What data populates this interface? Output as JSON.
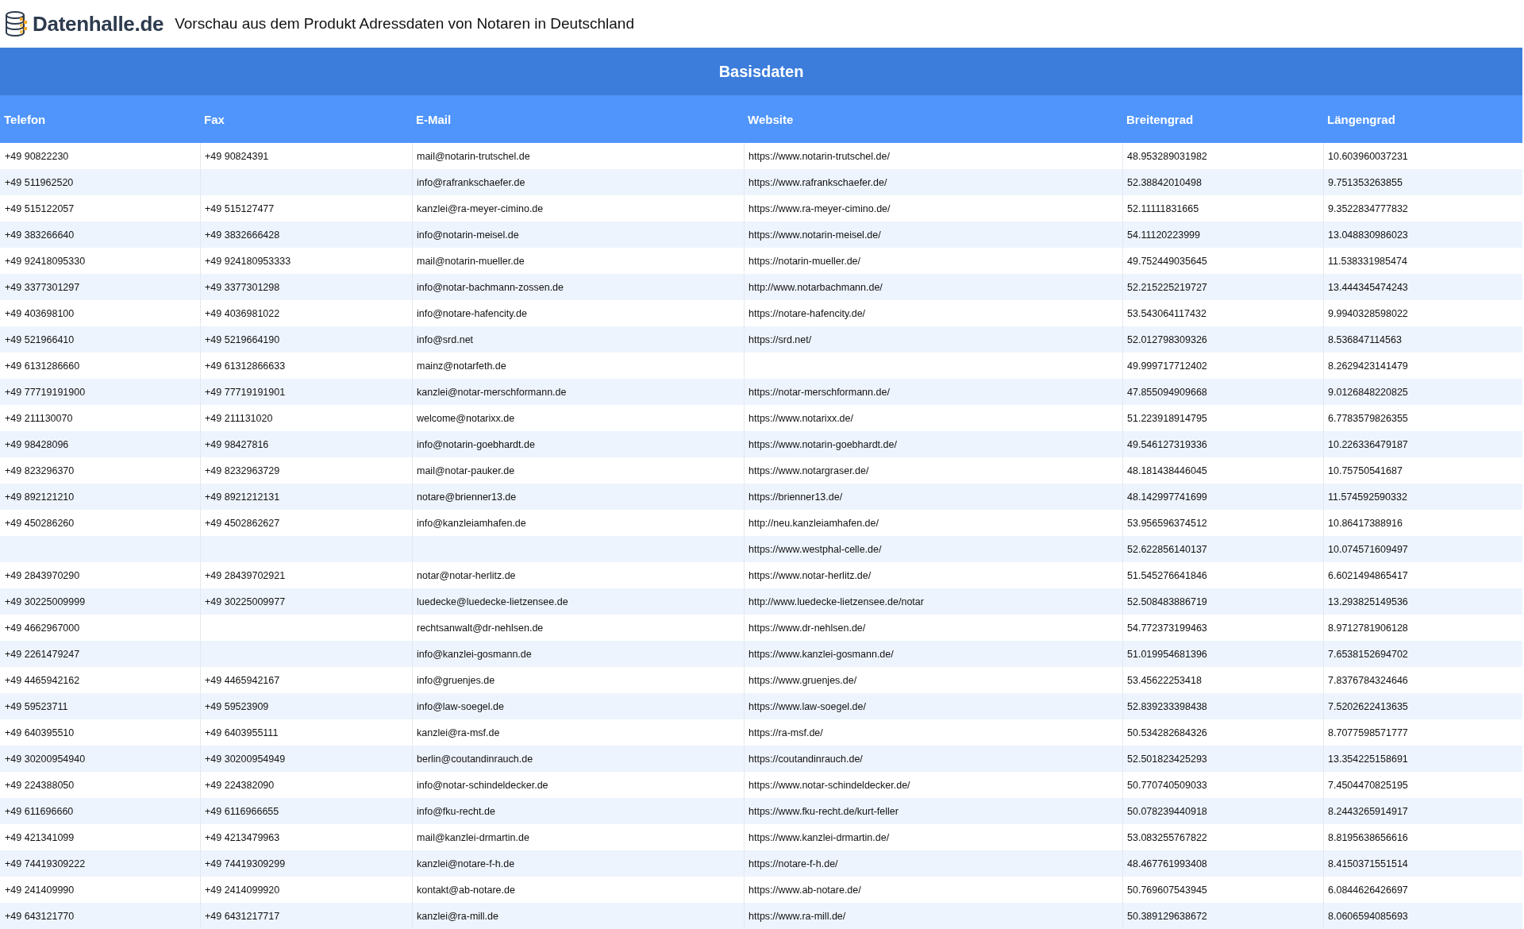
{
  "header": {
    "logo_text": "Datenhalle.de",
    "title": "Vorschau aus dem Produkt Adressdaten von Notaren in Deutschland"
  },
  "table": {
    "section_title": "Basisdaten",
    "columns": [
      "Telefon",
      "Fax",
      "E-Mail",
      "Website",
      "Breitengrad",
      "Längengrad"
    ],
    "rows": [
      {
        "phone": "+49 90822230",
        "fax": "+49 90824391",
        "email": "mail@notarin-trutschel.de",
        "website": "https://www.notarin-trutschel.de/",
        "latitude": "48.953289031982",
        "longitude": "10.603960037231"
      },
      {
        "phone": "+49 511962520",
        "email": "info@rafrankschaefer.de",
        "website": "https://www.rafrankschaefer.de/",
        "latitude": "52.38842010498",
        "longitude": "9.751353263855"
      },
      {
        "phone": "+49 515122057",
        "fax": "+49 515127477",
        "email": "kanzlei@ra-meyer-cimino.de",
        "website": "https://www.ra-meyer-cimino.de/",
        "latitude": "52.11111831665",
        "longitude": "9.3522834777832"
      },
      {
        "phone": "+49 383266640",
        "fax": "+49 3832666428",
        "email": "info@notarin-meisel.de",
        "website": "https://www.notarin-meisel.de/",
        "latitude": "54.11120223999",
        "longitude": "13.048830986023"
      },
      {
        "phone": "+49 92418095330",
        "fax": "+49 924180953333",
        "email": "mail@notarin-mueller.de",
        "website": "https://notarin-mueller.de/",
        "latitude": "49.752449035645",
        "longitude": "11.538331985474"
      },
      {
        "phone": "+49 3377301297",
        "fax": "+49 3377301298",
        "email": "info@notar-bachmann-zossen.de",
        "website": "http://www.notarbachmann.de/",
        "latitude": "52.215225219727",
        "longitude": "13.444345474243"
      },
      {
        "phone": "+49 403698100",
        "fax": "+49 4036981022",
        "email": "info@notare-hafencity.de",
        "website": "https://notare-hafencity.de/",
        "latitude": "53.543064117432",
        "longitude": "9.9940328598022"
      },
      {
        "phone": "+49 521966410",
        "fax": "+49 5219664190",
        "email": "info@srd.net",
        "website": "https://srd.net/",
        "latitude": "52.012798309326",
        "longitude": "8.536847114563"
      },
      {
        "phone": "+49 6131286660",
        "fax": "+49 61312866633",
        "email": "mainz@notarfeth.de",
        "latitude": "49.999717712402",
        "longitude": "8.2629423141479"
      },
      {
        "phone": "+49 77719191900",
        "fax": "+49 77719191901",
        "email": "kanzlei@notar-merschformann.de",
        "website": "https://notar-merschformann.de/",
        "latitude": "47.855094909668",
        "longitude": "9.0126848220825"
      },
      {
        "phone": "+49 211130070",
        "fax": "+49 211131020",
        "email": "welcome@notarixx.de",
        "website": "https://www.notarixx.de/",
        "latitude": "51.223918914795",
        "longitude": "6.7783579826355"
      },
      {
        "phone": "+49 98428096",
        "fax": "+49 98427816",
        "email": "info@notarin-goebhardt.de",
        "website": "https://www.notarin-goebhardt.de/",
        "latitude": "49.546127319336",
        "longitude": "10.226336479187"
      },
      {
        "phone": "+49 823296370",
        "fax": "+49 8232963729",
        "email": "mail@notar-pauker.de",
        "website": "https://www.notargraser.de/",
        "latitude": "48.181438446045",
        "longitude": "10.75750541687"
      },
      {
        "phone": "+49 892121210",
        "fax": "+49 8921212131",
        "email": "notare@brienner13.de",
        "website": "https://brienner13.de/",
        "latitude": "48.142997741699",
        "longitude": "11.574592590332"
      },
      {
        "phone": "+49 450286260",
        "fax": "+49 4502862627",
        "email": "info@kanzleiamhafen.de",
        "website": "http://neu.kanzleiamhafen.de/",
        "latitude": "53.956596374512",
        "longitude": "10.86417388916"
      },
      {
        "website": "https://www.westphal-celle.de/",
        "latitude": "52.622856140137",
        "longitude": "10.074571609497"
      },
      {
        "phone": "+49 2843970290",
        "fax": "+49 28439702921",
        "email": "notar@notar-herlitz.de",
        "website": "https://www.notar-herlitz.de/",
        "latitude": "51.545276641846",
        "longitude": "6.6021494865417"
      },
      {
        "phone": "+49 30225009999",
        "fax": "+49 30225009977",
        "email": "luedecke@luedecke-lietzensee.de",
        "website": "http://www.luedecke-lietzensee.de/notar",
        "latitude": "52.508483886719",
        "longitude": "13.293825149536"
      },
      {
        "phone": "+49 4662967000",
        "email": "rechtsanwalt@dr-nehlsen.de",
        "website": "https://www.dr-nehlsen.de/",
        "latitude": "54.772373199463",
        "longitude": "8.9712781906128"
      },
      {
        "phone": "+49 2261479247",
        "email": "info@kanzlei-gosmann.de",
        "website": "https://www.kanzlei-gosmann.de/",
        "latitude": "51.019954681396",
        "longitude": "7.6538152694702"
      },
      {
        "phone": "+49 4465942162",
        "fax": "+49 4465942167",
        "email": "info@gruenjes.de",
        "website": "https://www.gruenjes.de/",
        "latitude": "53.45622253418",
        "longitude": "7.8376784324646"
      },
      {
        "phone": "+49 59523711",
        "fax": "+49 59523909",
        "email": "info@law-soegel.de",
        "website": "https://www.law-soegel.de/",
        "latitude": "52.839233398438",
        "longitude": "7.5202622413635"
      },
      {
        "phone": "+49 640395510",
        "fax": "+49 6403955111",
        "email": "kanzlei@ra-msf.de",
        "website": "https://ra-msf.de/",
        "latitude": "50.534282684326",
        "longitude": "8.7077598571777"
      },
      {
        "phone": "+49 30200954940",
        "fax": "+49 30200954949",
        "email": "berlin@coutandinrauch.de",
        "website": "https://coutandinrauch.de/",
        "latitude": "52.501823425293",
        "longitude": "13.354225158691"
      },
      {
        "phone": "+49 224388050",
        "fax": "+49 224382090",
        "email": "info@notar-schindeldecker.de",
        "website": "https://www.notar-schindeldecker.de/",
        "latitude": "50.770740509033",
        "longitude": "7.4504470825195"
      },
      {
        "phone": "+49 611696660",
        "fax": "+49 6116966655",
        "email": "info@fku-recht.de",
        "website": "https://www.fku-recht.de/kurt-feller",
        "latitude": "50.078239440918",
        "longitude": "8.2443265914917"
      },
      {
        "phone": "+49 421341099",
        "fax": "+49 4213479963",
        "email": "mail@kanzlei-drmartin.de",
        "website": "https://www.kanzlei-drmartin.de/",
        "latitude": "53.083255767822",
        "longitude": "8.8195638656616"
      },
      {
        "phone": "+49 74419309222",
        "fax": "+49 74419309299",
        "email": "kanzlei@notare-f-h.de",
        "website": "https://notare-f-h.de/",
        "latitude": "48.467761993408",
        "longitude": "8.4150371551514"
      },
      {
        "phone": "+49 241409990",
        "fax": "+49 2414099920",
        "email": "kontakt@ab-notare.de",
        "website": "https://www.ab-notare.de/",
        "latitude": "50.769607543945",
        "longitude": "6.0844626426697"
      },
      {
        "phone": "+49 643121770",
        "fax": "+49 6431217717",
        "email": "kanzlei@ra-mill.de",
        "website": "https://www.ra-mill.de/",
        "latitude": "50.389129638672",
        "longitude": "8.0606594085693"
      }
    ]
  }
}
